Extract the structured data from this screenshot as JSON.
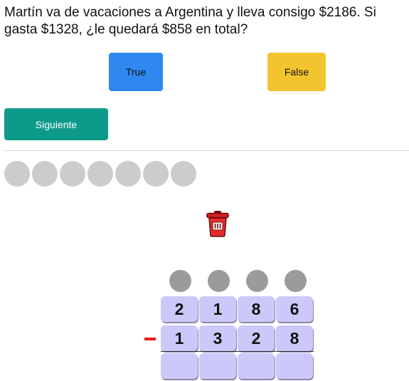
{
  "question": {
    "text": "Martín va de vacaciones a Argentina y lleva consigo $2186. Si gasta $1328, ¿le quedará $858 en total?"
  },
  "answers": {
    "true_label": "True",
    "false_label": "False",
    "true_color": "#2f88f0",
    "false_color": "#f2c530"
  },
  "navigation": {
    "next_label": "Siguiente",
    "next_color": "#0e9a8a"
  },
  "progress": {
    "total_steps": 7,
    "completed_steps": 0
  },
  "toolbar": {
    "trash_icon": "trash-icon"
  },
  "subtraction": {
    "operator": "minus",
    "minuend": [
      "2",
      "1",
      "8",
      "6"
    ],
    "subtrahend": [
      "1",
      "3",
      "2",
      "8"
    ],
    "result": [
      "",
      "",
      "",
      ""
    ],
    "carries": 4
  }
}
